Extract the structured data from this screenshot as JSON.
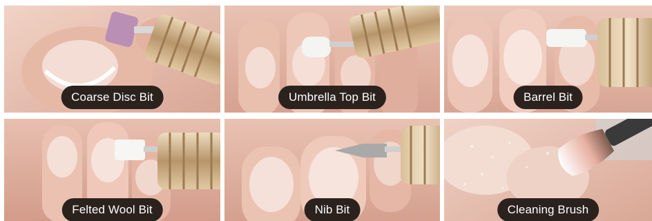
{
  "tiles": [
    {
      "caption": "Coarse Disc Bit"
    },
    {
      "caption": "Umbrella Top Bit"
    },
    {
      "caption": "Barrel Bit"
    },
    {
      "caption": "Felted Wool Bit"
    },
    {
      "caption": "Nib Bit"
    },
    {
      "caption": "Cleaning Brush"
    }
  ],
  "colors": {
    "label_bg": "#2b221e",
    "label_text": "#ffffff",
    "skin": "#e8c4b6",
    "gold_handle": "#c9ab82"
  }
}
